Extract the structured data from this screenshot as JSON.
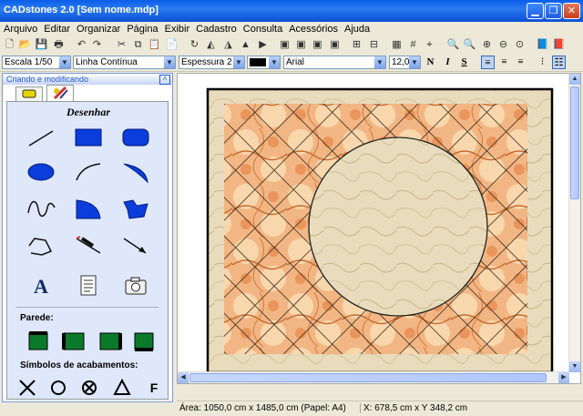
{
  "window": {
    "title": "CADstones 2.0  [Sem nome.mdp]"
  },
  "menu": [
    "Arquivo",
    "Editar",
    "Organizar",
    "Página",
    "Exibir",
    "Cadastro",
    "Consulta",
    "Acessórios",
    "Ajuda"
  ],
  "format_bar": {
    "scale": "Escala 1/50",
    "line_type": "Linha Contínua",
    "thickness": "Espessura 2",
    "font": "Arial",
    "font_size": "12,0",
    "bold": "N",
    "italic": "I",
    "underline": "S"
  },
  "panel": {
    "title": "Criando e modificando",
    "section_draw": "Desenhar",
    "section_wall": "Parede:",
    "section_finish": "Símbolos de acabamentos:",
    "finish_letter": "F"
  },
  "status": {
    "area": "Área: 1050,0 cm  x  1485,0 cm  (Papel: A4)",
    "coords": "X: 678,5 cm  x  Y 348,2 cm"
  },
  "colors": {
    "accent": "#215dc6",
    "shape_fill": "#0b3ddb"
  }
}
